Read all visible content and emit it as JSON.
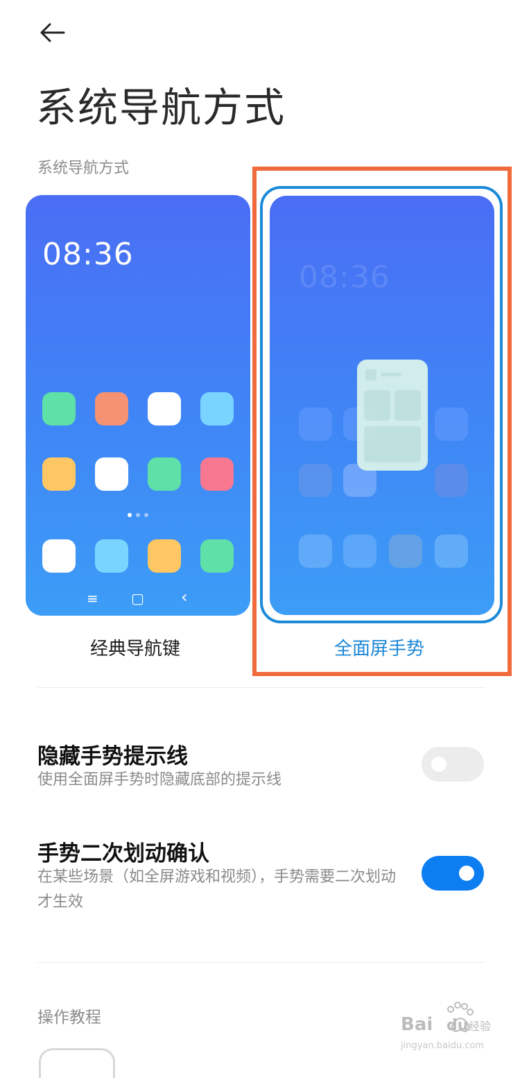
{
  "page": {
    "title": "系统导航方式"
  },
  "section": {
    "label": "系统导航方式"
  },
  "options": {
    "classic": {
      "label": "经典导航键",
      "clock": "08:36",
      "nav_keys": [
        "≡",
        "▢",
        "‹"
      ]
    },
    "gesture": {
      "label": "全面屏手势",
      "clock": "08:36",
      "selected": true
    }
  },
  "settings": [
    {
      "title": "隐藏手势提示线",
      "description": "使用全面屏手势时隐藏底部的提示线",
      "enabled": false
    },
    {
      "title": "手势二次划动确认",
      "description": "在某些场景（如全屏游戏和视频），手势需要二次划动才生效",
      "enabled": true
    }
  ],
  "tutorial": {
    "label": "操作教程"
  },
  "watermark": {
    "brand": "Bai du 经验",
    "url": "jingyan.baidu.com"
  },
  "colors": {
    "accent": "#1b86d6",
    "toggle_on": "#0c7ef2",
    "highlight": "#f06a3c"
  },
  "icons": [
    "back-arrow-icon",
    "menu-icon",
    "home-square-icon",
    "back-chevron-icon"
  ]
}
